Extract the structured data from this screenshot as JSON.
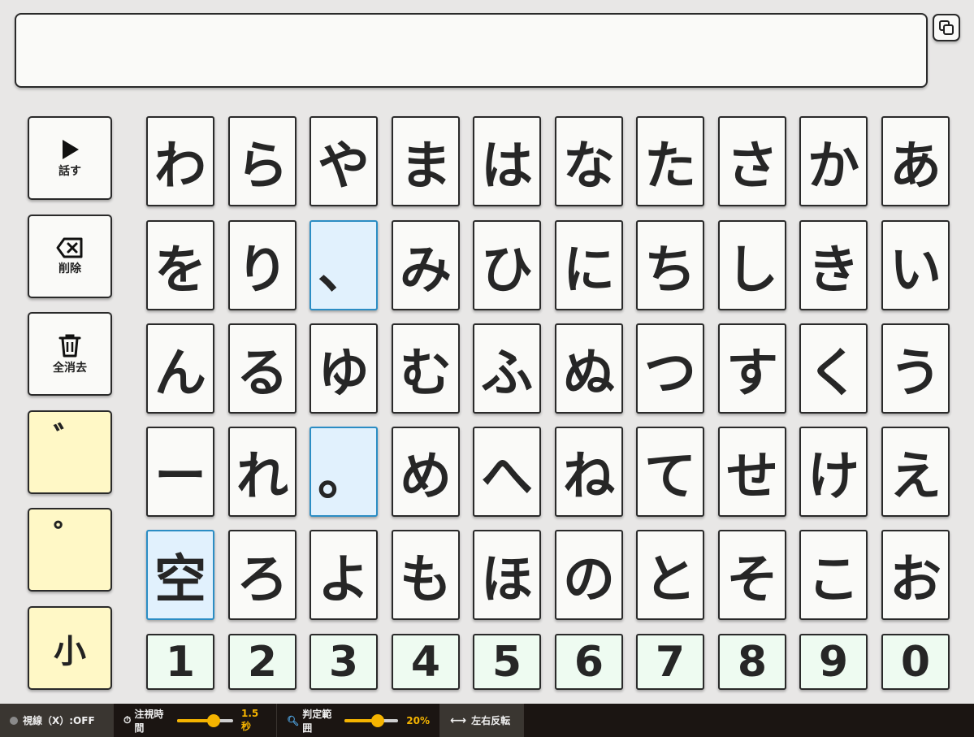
{
  "output_text": "",
  "side_buttons": {
    "speak": {
      "icon": "play-icon",
      "label": "話す"
    },
    "delete": {
      "icon": "backspace-icon",
      "label": "削除"
    },
    "clear": {
      "icon": "trash-icon",
      "label": "全消去"
    },
    "dakuten": {
      "label": "゛"
    },
    "handakuten": {
      "label": "゜"
    },
    "small": {
      "label": "小"
    }
  },
  "keys": [
    [
      "わ",
      "ら",
      "や",
      "ま",
      "は",
      "な",
      "た",
      "さ",
      "か",
      "あ"
    ],
    [
      "を",
      "り",
      "、",
      "み",
      "ひ",
      "に",
      "ち",
      "し",
      "き",
      "い"
    ],
    [
      "ん",
      "る",
      "ゆ",
      "む",
      "ふ",
      "ぬ",
      "つ",
      "す",
      "く",
      "う"
    ],
    [
      "ー",
      "れ",
      "。",
      "め",
      "へ",
      "ね",
      "て",
      "せ",
      "け",
      "え"
    ],
    [
      "空",
      "ろ",
      "よ",
      "も",
      "ほ",
      "の",
      "と",
      "そ",
      "こ",
      "お"
    ],
    [
      "1",
      "2",
      "3",
      "4",
      "5",
      "6",
      "7",
      "8",
      "9",
      "0"
    ]
  ],
  "status": {
    "gaze_label": "視線（X）:OFF",
    "dwell_label": "注視時間",
    "dwell_value": "1.5秒",
    "dwell_level": 0.65,
    "range_label": "判定範囲",
    "range_value": "20%",
    "range_level": 0.62,
    "flip_label": "左右反転"
  },
  "colors": {
    "accent": "#f5b400",
    "blue_key": "#e1f1fd",
    "yellow_key": "#fff8c6",
    "num_key": "#eefbf1"
  }
}
